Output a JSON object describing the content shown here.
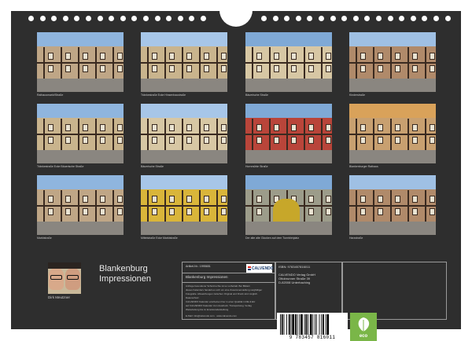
{
  "calendar": {
    "title_line1": "Blankenburg",
    "title_line2": "Impressionen",
    "author": "Dirk Meutzner"
  },
  "photos": [
    {
      "caption": "Rathausmarkt/Straße",
      "scene": "lane"
    },
    {
      "caption": "Tränkestraße Ecke Hinsenhaustraße",
      "scene": "corner"
    },
    {
      "caption": "Bäuerische Straße",
      "scene": "street"
    },
    {
      "caption": "Kinderstraße",
      "scene": "row"
    },
    {
      "caption": "Tränkestraße Ecke Bäuerische Straße",
      "scene": "corner"
    },
    {
      "caption": "Bäuerische Straße",
      "scene": "street"
    },
    {
      "caption": "Hornmühle Straße",
      "scene": "red"
    },
    {
      "caption": "Blankenburger Rathaus",
      "scene": "townhall"
    },
    {
      "caption": "Marktstraße",
      "scene": "lane"
    },
    {
      "caption": "Mittelstraße Ecke Marktstraße",
      "scene": "yellow"
    },
    {
      "caption": "Der alte alte Glocken auf dem Turmbleiplatz",
      "scene": "bell"
    },
    {
      "caption": "Harzstraße",
      "scene": "row"
    }
  ],
  "info": {
    "article_no": "Artikel-Nr.: 1995651",
    "calendar_name": "Blankenburg Impressionen",
    "isbn": "ISBN: 9783457816011",
    "publisher_lines": [
      "CALVENDO Verlag GmbH",
      "Ottobrunner Straße 39",
      "D-82008 Unterhaching"
    ],
    "logo_text": "CALVENDO",
    "fine_print": [
      "Anfrage besonderer Schutzrechte ist so vorbehalt. Bei Bildern",
      "dieses Kalenders handelt es sich um eine Zusammenstellung sorgfältiger",
      "Fotografie. Abweichungen zwischen Original und Druck sind möglich.",
      "Datenschutz.",
      "CALVENDO Kalender erscheinen hier in einer Qualität in DE & EU",
      "auf CALVENDO Kalender zum Ausdruck. Transportweg. Verlag",
      "Weiterleitung bis zu Emotionsdarstellung."
    ],
    "contact": "E-Mail: info@calvendo.com · www.calvendo.com",
    "barcode_number": "9 783457 816011",
    "eco_label": "eco"
  },
  "colors": {
    "cover": "#2e2e2e",
    "eco_green": "#7ab648"
  }
}
